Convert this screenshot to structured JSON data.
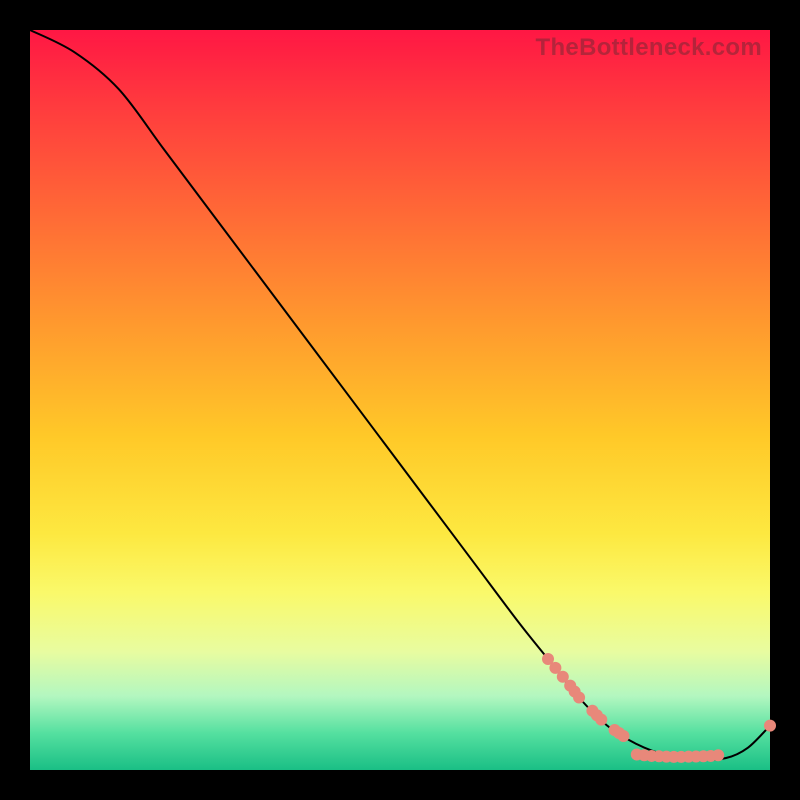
{
  "watermark": "TheBottleneck.com",
  "chart_data": {
    "type": "line",
    "title": "",
    "xlabel": "",
    "ylabel": "",
    "xlim": [
      0,
      100
    ],
    "ylim": [
      0,
      100
    ],
    "grid": false,
    "series": [
      {
        "name": "curve",
        "x": [
          0,
          6,
          12,
          18,
          24,
          30,
          36,
          42,
          48,
          54,
          60,
          66,
          70,
          74,
          78,
          82,
          86,
          90,
          94,
          97,
          100
        ],
        "y": [
          100,
          97,
          92,
          84,
          76,
          68,
          60,
          52,
          44,
          36,
          28,
          20,
          15,
          10,
          6,
          3.5,
          2,
          1.4,
          1.6,
          3,
          6
        ],
        "stroke": "#000000",
        "stroke_width": 2
      }
    ],
    "markers": [
      {
        "series": "dots",
        "x": 70,
        "y": 15.0
      },
      {
        "series": "dots",
        "x": 71,
        "y": 13.8
      },
      {
        "series": "dots",
        "x": 72,
        "y": 12.6
      },
      {
        "series": "dots",
        "x": 73,
        "y": 11.4
      },
      {
        "series": "dots",
        "x": 73.6,
        "y": 10.6
      },
      {
        "series": "dots",
        "x": 74.2,
        "y": 9.8
      },
      {
        "series": "dots",
        "x": 76,
        "y": 8.0
      },
      {
        "series": "dots",
        "x": 76.6,
        "y": 7.4
      },
      {
        "series": "dots",
        "x": 77.2,
        "y": 6.8
      },
      {
        "series": "dots",
        "x": 79,
        "y": 5.4
      },
      {
        "series": "dots",
        "x": 79.6,
        "y": 5.0
      },
      {
        "series": "dots",
        "x": 80.2,
        "y": 4.6
      },
      {
        "series": "dots",
        "x": 82,
        "y": 2.1
      },
      {
        "series": "dots",
        "x": 83,
        "y": 2.0
      },
      {
        "series": "dots",
        "x": 84,
        "y": 1.9
      },
      {
        "series": "dots",
        "x": 85,
        "y": 1.85
      },
      {
        "series": "dots",
        "x": 86,
        "y": 1.8
      },
      {
        "series": "dots",
        "x": 87,
        "y": 1.78
      },
      {
        "series": "dots",
        "x": 88,
        "y": 1.78
      },
      {
        "series": "dots",
        "x": 89,
        "y": 1.8
      },
      {
        "series": "dots",
        "x": 90,
        "y": 1.82
      },
      {
        "series": "dots",
        "x": 91,
        "y": 1.85
      },
      {
        "series": "dots",
        "x": 92,
        "y": 1.9
      },
      {
        "series": "dots",
        "x": 93,
        "y": 2.0
      },
      {
        "series": "dots",
        "x": 100,
        "y": 6.0
      }
    ],
    "marker_style": {
      "color": "#e8887a",
      "radius": 6
    },
    "label_marker": {
      "x": 87.5,
      "y": 1.9,
      "text": "",
      "color": "#c97060"
    }
  }
}
